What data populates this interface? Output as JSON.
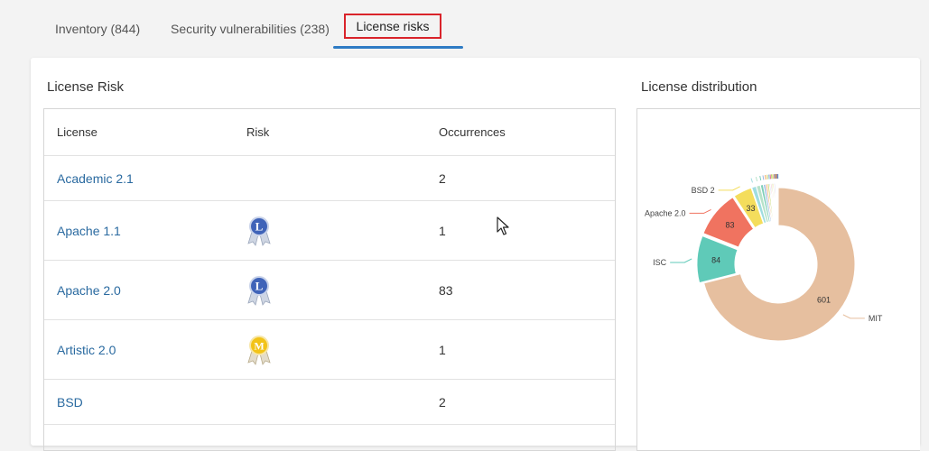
{
  "tabs": [
    {
      "label": "Inventory (844)"
    },
    {
      "label": "Security vulnerabilities (238)"
    },
    {
      "label": "License risks"
    }
  ],
  "license_risk": {
    "title": "License Risk",
    "columns": {
      "license": "License",
      "risk": "Risk",
      "occurrences": "Occurrences"
    },
    "rows": [
      {
        "license": "Academic 2.1",
        "risk": "",
        "occurrences": "2"
      },
      {
        "license": "Apache 1.1",
        "risk": "L",
        "occurrences": "1"
      },
      {
        "license": "Apache 2.0",
        "risk": "L",
        "occurrences": "83"
      },
      {
        "license": "Artistic 2.0",
        "risk": "M",
        "occurrences": "1"
      },
      {
        "license": "BSD",
        "risk": "",
        "occurrences": "2"
      }
    ]
  },
  "license_distribution": {
    "title": "License distribution"
  },
  "colors": {
    "risk_low": "#3f63b8",
    "risk_medium": "#f2c318",
    "link": "#2a6aa0",
    "active_tab_outline": "#d9232a",
    "active_tab_underline": "#2e7bc4"
  },
  "chart_data": {
    "type": "pie",
    "style": "donut",
    "slices": [
      {
        "label": "MIT",
        "value": 601,
        "color": "#e6bf9f"
      },
      {
        "label": "ISC",
        "value": 84,
        "color": "#5fcab8"
      },
      {
        "label": "Apache 2.0",
        "value": 83,
        "color": "#f07360"
      },
      {
        "label": "BSD 2",
        "value": 33,
        "color": "#f4dd5c"
      },
      {
        "label": "",
        "value": 8,
        "color": "#9fdde0"
      },
      {
        "label": "",
        "value": 7,
        "color": "#b7e2c9"
      },
      {
        "label": "",
        "value": 5,
        "color": "#7fcfb8"
      },
      {
        "label": "",
        "value": 4,
        "color": "#9ab9e0"
      },
      {
        "label": "",
        "value": 3,
        "color": "#f4a25d"
      },
      {
        "label": "",
        "value": 3,
        "color": "#c5d76a"
      },
      {
        "label": "",
        "value": 2,
        "color": "#7fb3e6"
      },
      {
        "label": "",
        "value": 2,
        "color": "#e56f8f"
      },
      {
        "label": "",
        "value": 2,
        "color": "#a6d25d"
      },
      {
        "label": "",
        "value": 2,
        "color": "#f5c35c"
      },
      {
        "label": "",
        "value": 2,
        "color": "#8c8fd6"
      },
      {
        "label": "",
        "value": 1,
        "color": "#e07a3a"
      },
      {
        "label": "",
        "value": 1,
        "color": "#6cc36c"
      },
      {
        "label": "",
        "value": 1,
        "color": "#c47fd0"
      },
      {
        "label": "",
        "value": 1,
        "color": "#e45a4a"
      },
      {
        "label": "",
        "value": 1,
        "color": "#3f9fd9"
      }
    ],
    "data_labels_shown": [
      "601",
      "84",
      "83",
      "33"
    ]
  }
}
